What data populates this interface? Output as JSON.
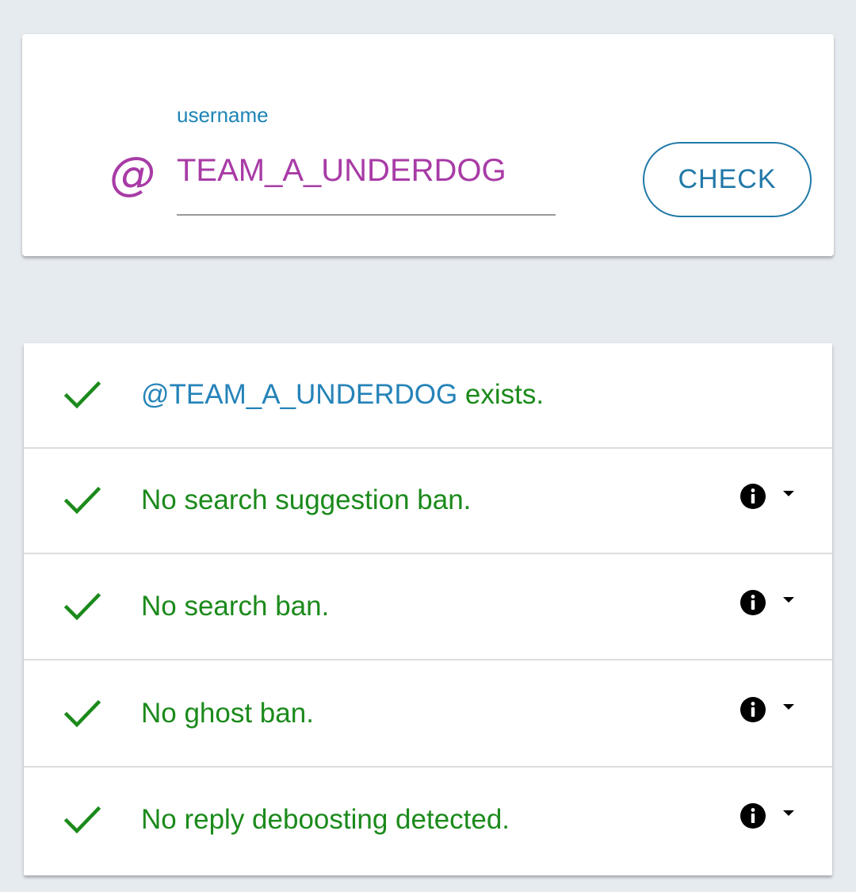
{
  "colors": {
    "label_blue": "#1d84b5",
    "accent_purple": "#a83ba6",
    "button_blue": "#2179a8",
    "success_green": "#1b8a1b",
    "handle_blue": "#2583b8",
    "info_black": "#000000",
    "background": "#e6ebf0"
  },
  "search": {
    "at_symbol": "@",
    "label": "username",
    "value": "TEAM_A_UNDERDOG",
    "check_button": "CHECK"
  },
  "results": [
    {
      "icon": "checkmark-icon",
      "handle": "@TEAM_A_UNDERDOG",
      "text": " exists.",
      "has_info": false
    },
    {
      "icon": "checkmark-icon",
      "text": "No search suggestion ban.",
      "has_info": true,
      "info_icon": "info-icon",
      "expand_icon": "dropdown-arrow-icon"
    },
    {
      "icon": "checkmark-icon",
      "text": "No search ban.",
      "has_info": true,
      "info_icon": "info-icon",
      "expand_icon": "dropdown-arrow-icon"
    },
    {
      "icon": "checkmark-icon",
      "text": "No ghost ban.",
      "has_info": true,
      "info_icon": "info-icon",
      "expand_icon": "dropdown-arrow-icon"
    },
    {
      "icon": "checkmark-icon",
      "text": "No reply deboosting detected.",
      "has_info": true,
      "info_icon": "info-icon",
      "expand_icon": "dropdown-arrow-icon"
    }
  ]
}
